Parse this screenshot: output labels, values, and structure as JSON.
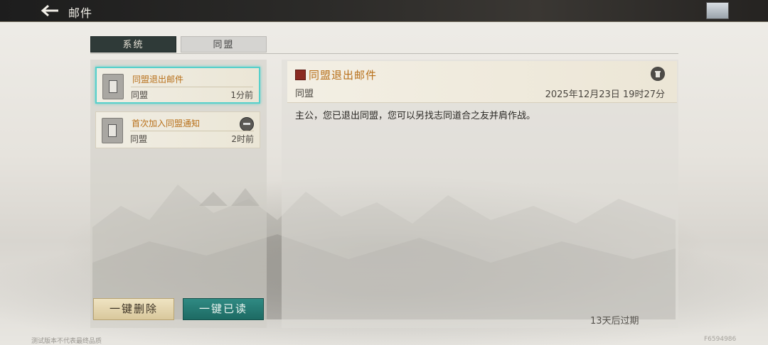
{
  "header": {
    "title": "邮件"
  },
  "tabs": [
    {
      "label": "系统",
      "active": true
    },
    {
      "label": "同盟",
      "active": false
    }
  ],
  "mail_list": [
    {
      "subject": "同盟退出邮件",
      "sender": "同盟",
      "time": "1分前",
      "selected": true
    },
    {
      "subject": "首次加入同盟通知",
      "sender": "同盟",
      "time": "2时前",
      "selected": false
    }
  ],
  "actions": {
    "delete_all": "一键删除",
    "read_all": "一键已读"
  },
  "detail": {
    "title": "同盟退出邮件",
    "sender": "同盟",
    "date": "2025年12月23日 19时27分",
    "body": "主公，您已退出同盟，您可以另找志同道合之友并肩作战。",
    "expire": "13天后过期"
  },
  "footer": {
    "left": "测试版本不代表最终品质",
    "right": "F6594986"
  },
  "colors": {
    "accent_teal": "#57d0cb",
    "subject_orange": "#b8701a",
    "tab_active": "#2f3a38"
  }
}
